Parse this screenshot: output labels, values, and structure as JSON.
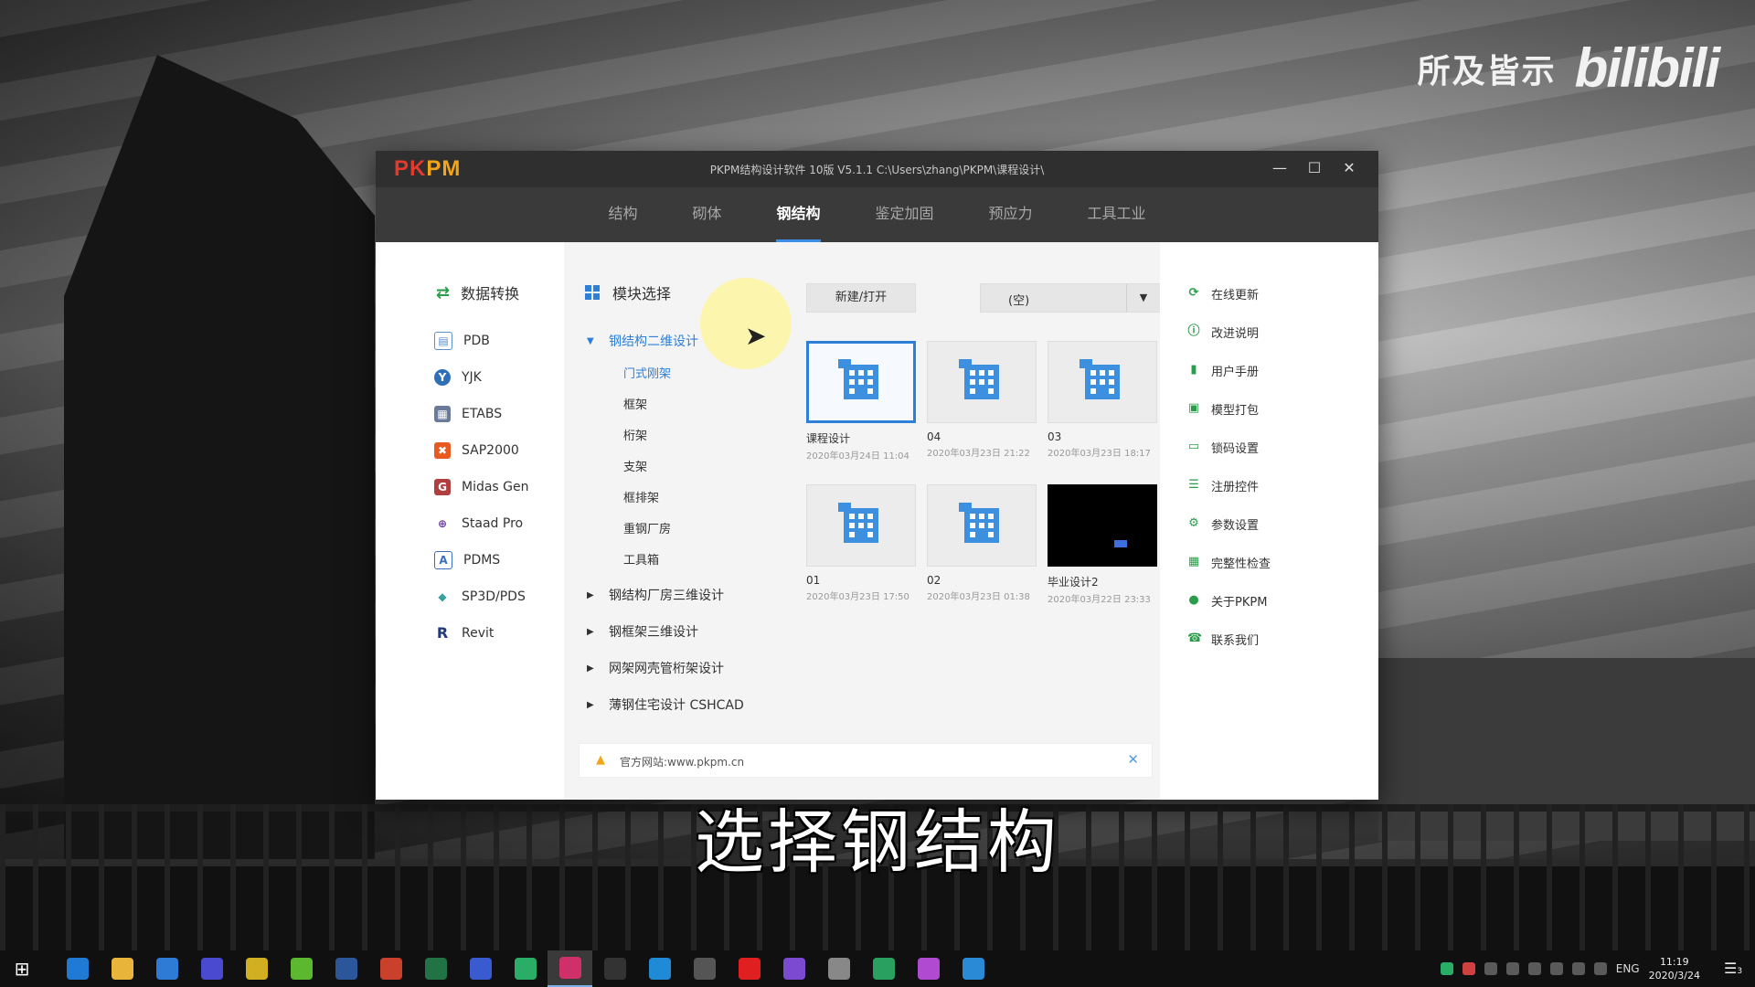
{
  "window": {
    "logo_part1": "PK",
    "logo_part2": "PM",
    "title": "PKPM结构设计软件 10版 V5.1.1    C:\\Users\\zhang\\PKPM\\课程设计\\"
  },
  "menu": {
    "tabs": [
      {
        "label": "结构"
      },
      {
        "label": "砌体"
      },
      {
        "label": "钢结构",
        "active": true
      },
      {
        "label": "鉴定加固"
      },
      {
        "label": "预应力"
      },
      {
        "label": "工具工业"
      }
    ]
  },
  "left": {
    "heading": "数据转换",
    "sources": [
      {
        "label": "PDB",
        "icon": "pdb-icon",
        "color": "#5b8fd0"
      },
      {
        "label": "YJK",
        "icon": "yjk-icon",
        "color": "#2f6fb8"
      },
      {
        "label": "ETABS",
        "icon": "etabs-icon",
        "color": "#6a7a9a"
      },
      {
        "label": "SAP2000",
        "icon": "sap2000-icon",
        "color": "#e85a1f"
      },
      {
        "label": "Midas Gen",
        "icon": "midas-icon",
        "color": "#b04040"
      },
      {
        "label": "Staad Pro",
        "icon": "staad-icon",
        "color": "#6a3aa8"
      },
      {
        "label": "PDMS",
        "icon": "pdms-icon",
        "color": "#3a6fc0"
      },
      {
        "label": "SP3D/PDS",
        "icon": "sp3d-icon",
        "color": "#3aa0a0"
      },
      {
        "label": "Revit",
        "icon": "revit-icon",
        "color": "#1f3a7a"
      }
    ]
  },
  "middle": {
    "heading": "模块选择",
    "tree": {
      "open_node": "钢结构二维设计",
      "children": [
        "门式刚架",
        "框架",
        "桁架",
        "支架",
        "框排架",
        "重钢厂房",
        "工具箱"
      ],
      "selected_child": "门式刚架",
      "collapsed_nodes": [
        "钢结构厂房三维设计",
        "钢框架三维设计",
        "网架网壳管桁架设计",
        "薄钢住宅设计 CSHCAD"
      ]
    },
    "open_button": "新建/打开",
    "select_value": "(空)",
    "projects": [
      {
        "name": "课程设计",
        "date": "2020年03月24日 11:04",
        "selected": true
      },
      {
        "name": "04",
        "date": "2020年03月23日 21:22"
      },
      {
        "name": "03",
        "date": "2020年03月23日 18:17"
      },
      {
        "name": "01",
        "date": "2020年03月23日 17:50"
      },
      {
        "name": "02",
        "date": "2020年03月23日 01:38"
      },
      {
        "name": "毕业设计2",
        "date": "2020年03月22日 23:33",
        "dark": true
      }
    ],
    "notice": "官方网站:www.pkpm.cn"
  },
  "right": {
    "items": [
      {
        "label": "在线更新",
        "icon": "refresh-icon"
      },
      {
        "label": "改进说明",
        "icon": "info-icon"
      },
      {
        "label": "用户手册",
        "icon": "book-icon"
      },
      {
        "label": "模型打包",
        "icon": "package-icon"
      },
      {
        "label": "锁码设置",
        "icon": "monitor-icon"
      },
      {
        "label": "注册控件",
        "icon": "register-icon"
      },
      {
        "label": "参数设置",
        "icon": "gear-icon"
      },
      {
        "label": "完整性检查",
        "icon": "check-doc-icon"
      },
      {
        "label": "关于PKPM",
        "icon": "user-icon"
      },
      {
        "label": "联系我们",
        "icon": "phone-icon"
      }
    ]
  },
  "overlay": {
    "watermark_text": "所及皆示",
    "watermark_logo": "bilibili",
    "subtitle": "选择钢结构"
  },
  "taskbar": {
    "icons": [
      {
        "name": "edge-icon",
        "color": "#1f7ad6"
      },
      {
        "name": "file-explorer-icon",
        "color": "#e8b43a"
      },
      {
        "name": "mail-icon",
        "color": "#2e7bd6"
      },
      {
        "name": "save-disk-icon",
        "color": "#4a4ad0"
      },
      {
        "name": "app-yellow-icon",
        "color": "#d0b020"
      },
      {
        "name": "app-green-icon",
        "color": "#5cb82f"
      },
      {
        "name": "word-icon",
        "color": "#2b579a"
      },
      {
        "name": "powerpoint-icon",
        "color": "#c9412a"
      },
      {
        "name": "excel-icon",
        "color": "#217346"
      },
      {
        "name": "en-dictionary-icon",
        "color": "#3a5ad0"
      },
      {
        "name": "wechat-icon",
        "color": "#2aae67"
      },
      {
        "name": "pkpm-icon",
        "color": "#d0306a",
        "active": true
      },
      {
        "name": "qq-icon",
        "color": "#333333"
      },
      {
        "name": "photos-icon",
        "color": "#1f8ad6"
      },
      {
        "name": "fox-icon",
        "color": "#555555"
      },
      {
        "name": "record-icon",
        "color": "#e02020"
      },
      {
        "name": "cortana-icon",
        "color": "#7a4ad0"
      },
      {
        "name": "app-gray-icon",
        "color": "#888888"
      },
      {
        "name": "monitor-app-icon",
        "color": "#2aa060"
      },
      {
        "name": "app-purple-icon",
        "color": "#b04ad0"
      },
      {
        "name": "app-blue-icon",
        "color": "#2a8ad6"
      }
    ],
    "lang": "ENG",
    "time": "11:19",
    "date": "2020/3/24",
    "notifications": "3"
  }
}
